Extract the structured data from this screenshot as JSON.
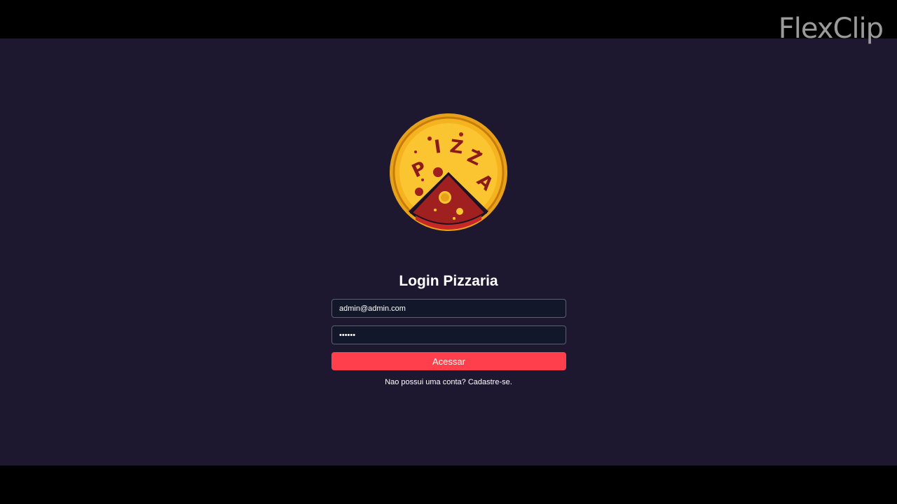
{
  "watermark": {
    "text": "FlexClip"
  },
  "logo": {
    "text": "PIZZA",
    "letters": [
      "P",
      "I",
      "Z",
      "Z",
      "A"
    ]
  },
  "login": {
    "title": "Login Pizzaria",
    "email_value": "admin@admin.com",
    "password_value": "••••••",
    "submit_label": "Acessar",
    "signup_link": "Nao possui uma conta? Cadastre-se."
  },
  "colors": {
    "background": "#1d1730",
    "letterbox": "#000000",
    "accent": "#ff3f4b",
    "input_bg": "#121829",
    "pizza_crust": "#f5a623",
    "pizza_cheese": "#fbc531",
    "pizza_sauce": "#a01f1f"
  }
}
